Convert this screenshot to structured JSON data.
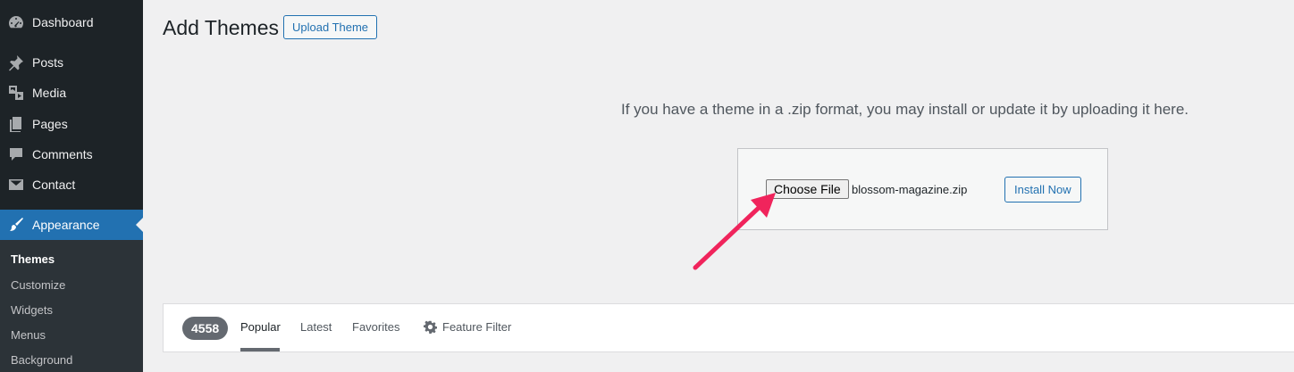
{
  "sidebar": {
    "items": [
      {
        "label": "Dashboard",
        "icon": "dashboard-icon"
      },
      {
        "label": "Posts",
        "icon": "pin-icon"
      },
      {
        "label": "Media",
        "icon": "media-icon"
      },
      {
        "label": "Pages",
        "icon": "pages-icon"
      },
      {
        "label": "Comments",
        "icon": "comments-icon"
      },
      {
        "label": "Contact",
        "icon": "mail-icon"
      },
      {
        "label": "Appearance",
        "icon": "paintbrush-icon"
      }
    ],
    "submenu": [
      "Themes",
      "Customize",
      "Widgets",
      "Menus",
      "Background"
    ]
  },
  "header": {
    "title": "Add Themes",
    "upload_label": "Upload Theme"
  },
  "upload": {
    "help_text": "If you have a theme in a .zip format, you may install or update it by uploading it here.",
    "choose_label": "Choose File",
    "file_name": "blossom-magazine.zip",
    "install_label": "Install Now"
  },
  "filters": {
    "count": "4558",
    "tabs": [
      "Popular",
      "Latest",
      "Favorites"
    ],
    "feature_filter": "Feature Filter"
  },
  "colors": {
    "sidebar_bg": "#1d2327",
    "accent": "#2271b1",
    "arrow": "#f0245c"
  }
}
